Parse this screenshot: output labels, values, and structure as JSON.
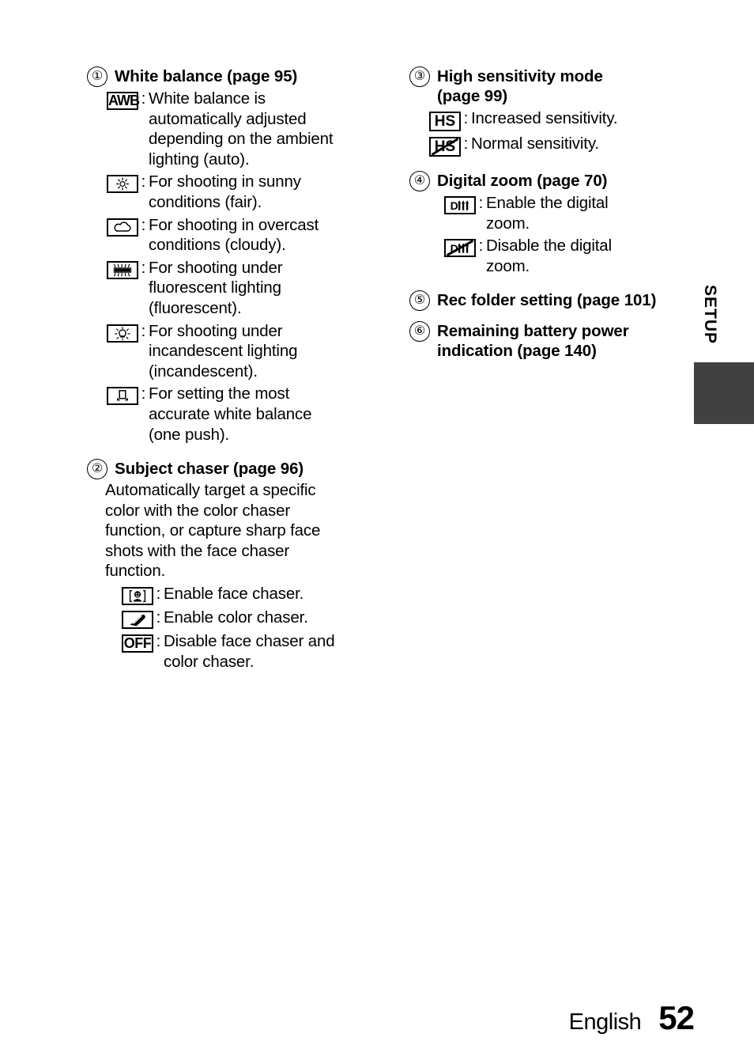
{
  "page": {
    "language": "English",
    "number": "52",
    "side_tab_label": "SETUP",
    "side_tab_color": "#414141"
  },
  "left_column": {
    "items": [
      {
        "marker": "①",
        "heading": "White balance (page 95)",
        "definitions": [
          {
            "icon": "awb-icon",
            "icon_label": "AWB",
            "colon": ":",
            "text": "White balance is\nautomatically adjusted\ndepending on the ambient\nlighting (auto)."
          },
          {
            "icon": "sun-icon",
            "icon_label": "",
            "colon": ":",
            "text": "For shooting in sunny\nconditions (fair)."
          },
          {
            "icon": "cloud-icon",
            "icon_label": "",
            "colon": ":",
            "text": "For shooting in overcast\nconditions (cloudy)."
          },
          {
            "icon": "fluorescent-icon",
            "icon_label": "",
            "colon": ":",
            "text": "For shooting under\nfluorescent lighting\n(fluorescent)."
          },
          {
            "icon": "incandescent-icon",
            "icon_label": "",
            "colon": ":",
            "text": "For shooting under\nincandescent lighting\n(incandescent)."
          },
          {
            "icon": "one-push-icon",
            "icon_label": "",
            "colon": ":",
            "text": "For setting the most\naccurate white balance\n(one push)."
          }
        ]
      },
      {
        "marker": "②",
        "heading": "Subject chaser (page 96)",
        "paragraph": "Automatically target a specific\ncolor with the color chaser\nfunction, or capture sharp face\nshots with the face chaser\nfunction.",
        "definitions": [
          {
            "icon": "face-chaser-icon",
            "icon_label": "",
            "colon": ":",
            "text": "Enable face chaser."
          },
          {
            "icon": "color-chaser-icon",
            "icon_label": "",
            "colon": ":",
            "text": "Enable color chaser."
          },
          {
            "icon": "off-icon",
            "icon_label": "OFF",
            "colon": ":",
            "text": "Disable face chaser and\ncolor chaser."
          }
        ]
      }
    ]
  },
  "right_column": {
    "items": [
      {
        "marker": "③",
        "heading": "High sensitivity mode\n(page 99)",
        "definitions": [
          {
            "icon": "hs-on-icon",
            "icon_label": "HS",
            "colon": ":",
            "text": "Increased sensitivity."
          },
          {
            "icon": "hs-off-icon",
            "icon_label": "HS",
            "colon": ":",
            "text": "Normal sensitivity."
          }
        ]
      },
      {
        "marker": "④",
        "heading": "Digital zoom (page 70)",
        "definitions": [
          {
            "icon": "digital-zoom-on-icon",
            "icon_label": "",
            "colon": ":",
            "text": "Enable the digital\nzoom."
          },
          {
            "icon": "digital-zoom-off-icon",
            "icon_label": "",
            "colon": ":",
            "text": "Disable the digital\nzoom."
          }
        ]
      },
      {
        "marker": "⑤",
        "heading": "Rec folder setting (page 101)",
        "definitions": []
      },
      {
        "marker": "⑥",
        "heading": "Remaining battery power\nindication (page 140)",
        "definitions": []
      }
    ]
  }
}
